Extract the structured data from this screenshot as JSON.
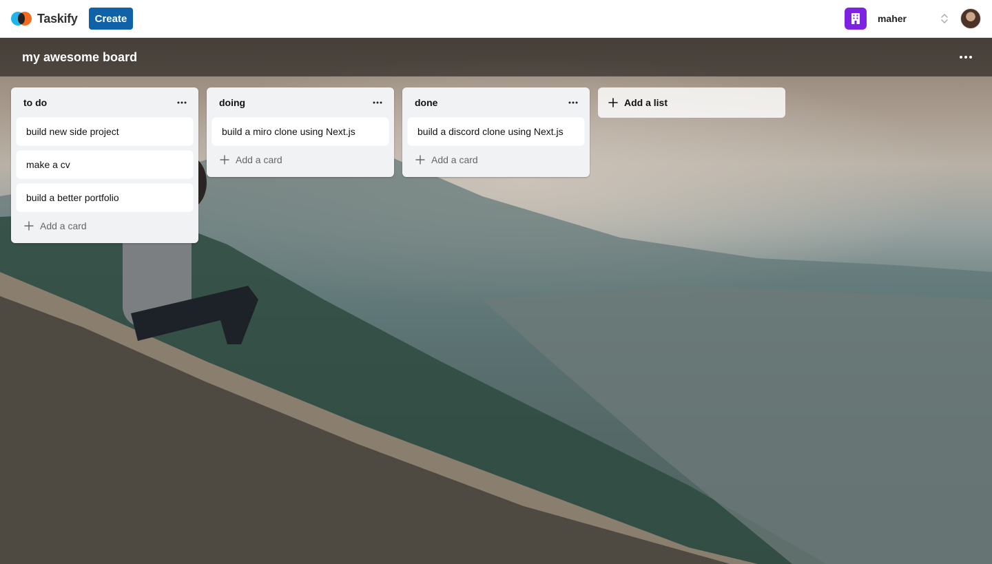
{
  "app": {
    "name": "Taskify"
  },
  "navbar": {
    "create_label": "Create",
    "org_name": "maher"
  },
  "board": {
    "title": "my awesome board",
    "add_list_label": "Add a list",
    "add_card_label": "Add a card",
    "lists": [
      {
        "title": "to do",
        "cards": [
          "build new side project",
          "make a cv",
          "build a better portfolio"
        ]
      },
      {
        "title": "doing",
        "cards": [
          "build a miro clone using Next.js"
        ]
      },
      {
        "title": "done",
        "cards": [
          "build a discord clone using Next.js"
        ]
      }
    ]
  },
  "icons": {
    "org": "building-icon",
    "switcher": "chevrons-up-down-icon",
    "menu": "more-horizontal-icon",
    "add": "plus-icon"
  },
  "colors": {
    "create_button": "#0f62a8",
    "org_avatar": "#7c22e0",
    "list_bg": "#f1f2f4"
  }
}
